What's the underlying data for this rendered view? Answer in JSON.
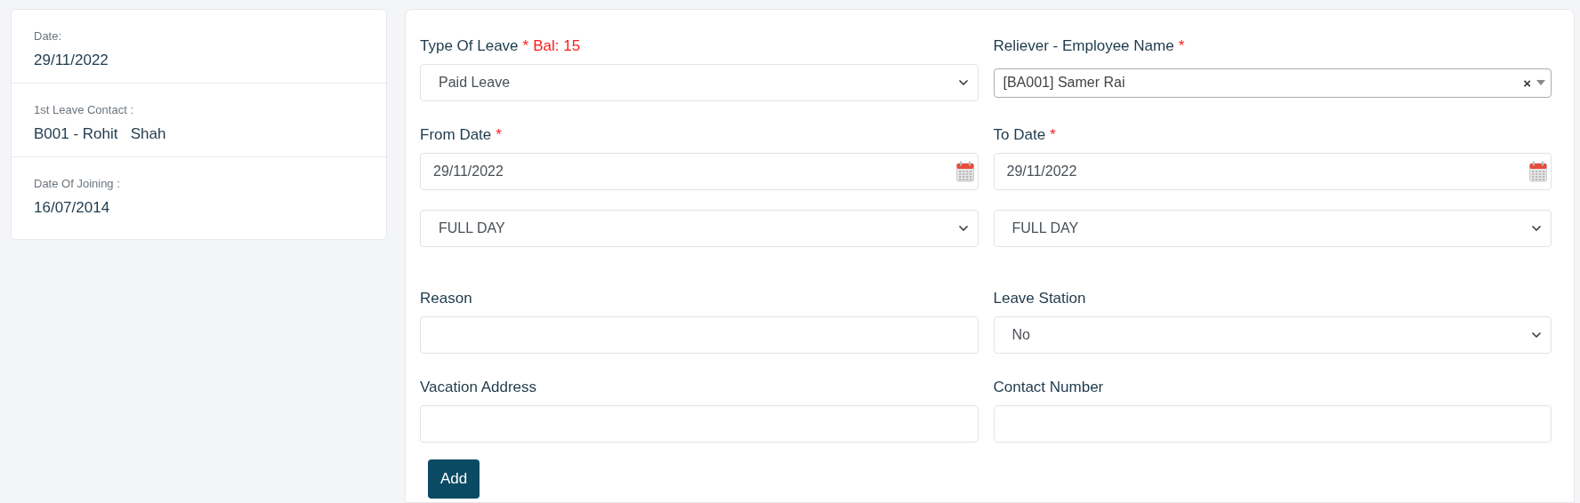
{
  "summary": [
    {
      "label": "Date:",
      "value": "29/11/2022"
    },
    {
      "label": "1st Leave Contact :",
      "value": "B001 - Rohit   Shah"
    },
    {
      "label": "Date Of Joining :",
      "value": "16/07/2014"
    }
  ],
  "form": {
    "rows": [
      [
        {
          "kind": "select",
          "label": "Type Of Leave",
          "marker": "*",
          "note": "Bal: 15",
          "value": "Paid Leave"
        },
        {
          "kind": "combobox",
          "label": "Reliever - Employee Name",
          "marker": "*",
          "value": "[BA001] Samer Rai",
          "clear": "×"
        }
      ],
      [
        {
          "kind": "date",
          "label": "From Date",
          "marker": "*",
          "value": "29/11/2022"
        },
        {
          "kind": "date",
          "label": "To Date",
          "marker": "*",
          "value": "29/11/2022"
        }
      ],
      [
        {
          "kind": "select",
          "value": "FULL DAY"
        },
        {
          "kind": "select",
          "value": "FULL DAY"
        }
      ],
      [
        {
          "kind": "input",
          "label": "Reason"
        },
        {
          "kind": "select",
          "label": "Leave Station",
          "value": "No"
        }
      ],
      [
        {
          "kind": "input",
          "label": "Vacation Address"
        },
        {
          "kind": "input",
          "label": "Contact Number"
        }
      ]
    ],
    "submit": "Add"
  }
}
